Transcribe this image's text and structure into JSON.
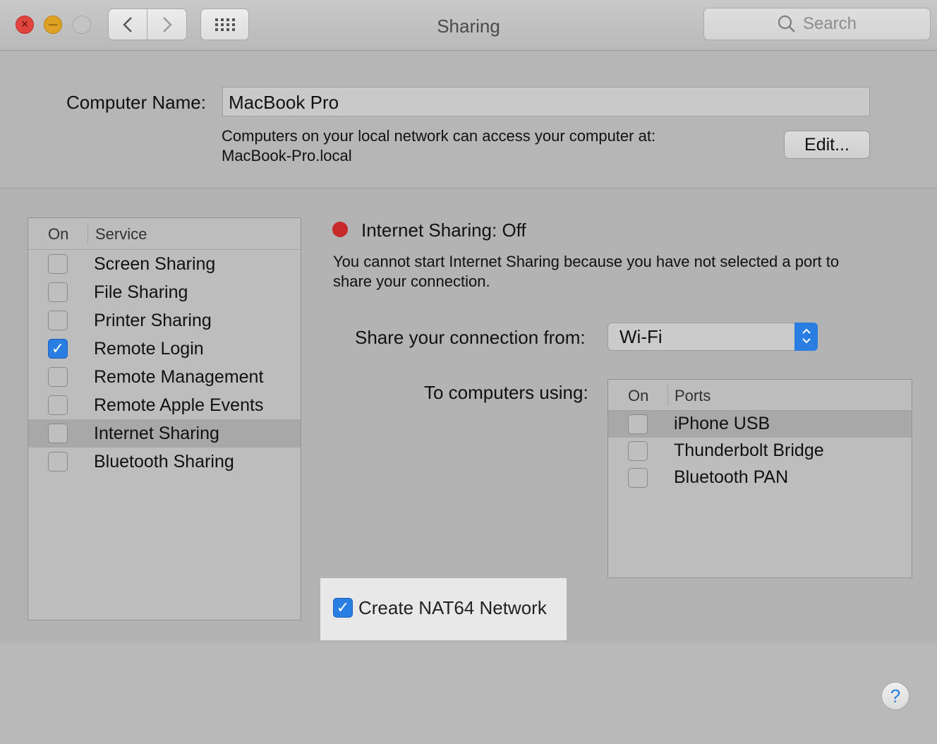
{
  "window": {
    "title": "Sharing"
  },
  "toolbar": {
    "search_placeholder": "Search",
    "back_glyph": "‹",
    "forward_glyph": "›",
    "grid_glyph": "⠿"
  },
  "computer_name": {
    "label": "Computer Name:",
    "value": "MacBook Pro",
    "description_line1": "Computers on your local network can access your computer at:",
    "description_line2": "MacBook-Pro.local",
    "edit_label": "Edit..."
  },
  "services": {
    "header_on": "On",
    "header_service": "Service",
    "items": [
      {
        "label": "Screen Sharing",
        "checked": false,
        "selected": false
      },
      {
        "label": "File Sharing",
        "checked": false,
        "selected": false
      },
      {
        "label": "Printer Sharing",
        "checked": false,
        "selected": false
      },
      {
        "label": "Remote Login",
        "checked": true,
        "selected": false
      },
      {
        "label": "Remote Management",
        "checked": false,
        "selected": false
      },
      {
        "label": "Remote Apple Events",
        "checked": false,
        "selected": false
      },
      {
        "label": "Internet Sharing",
        "checked": false,
        "selected": true
      },
      {
        "label": "Bluetooth Sharing",
        "checked": false,
        "selected": false
      }
    ]
  },
  "detail": {
    "status": "Internet Sharing: Off",
    "status_color": "#c62a2a",
    "message_line1": "You cannot start Internet Sharing because you have not selected a port to",
    "message_line2": "share your connection.",
    "share_from_label": "Share your connection from:",
    "share_from_value": "Wi-Fi",
    "to_computers_label": "To computers using:",
    "ports_header_on": "On",
    "ports_header_ports": "Ports",
    "ports": [
      {
        "label": "iPhone USB",
        "checked": false,
        "selected": true
      },
      {
        "label": "Thunderbolt Bridge",
        "checked": false,
        "selected": false
      },
      {
        "label": "Bluetooth PAN",
        "checked": false,
        "selected": false
      }
    ],
    "nat64_label": "Create NAT64 Network",
    "nat64_checked": true
  },
  "help_label": "?",
  "colors": {
    "accent": "#2a7de1"
  }
}
